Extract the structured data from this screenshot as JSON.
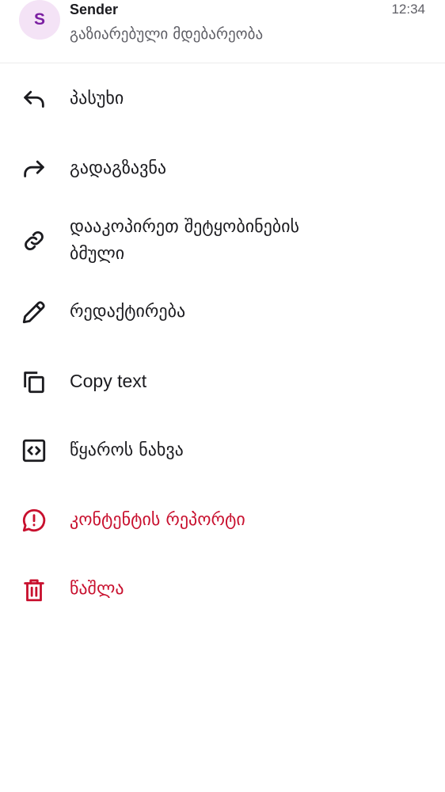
{
  "header": {
    "avatar_letter": "S",
    "sender_name": "Sender",
    "preview": "გაზიარებული მდებარეობა",
    "time": "12:34"
  },
  "menu": {
    "items": [
      {
        "label": "პასუხი",
        "icon": "reply-icon"
      },
      {
        "label": "გადაგზავნა",
        "icon": "forward-icon"
      },
      {
        "label_line1": "დააკოპირეთ შეტყობინების",
        "label_line2": "ბმული",
        "icon": "link-icon"
      },
      {
        "label": "რედაქტირება",
        "icon": "pencil-icon"
      },
      {
        "label": "Copy text",
        "icon": "copy-icon"
      },
      {
        "label": "წყაროს ნახვა",
        "icon": "code-icon"
      },
      {
        "label": "კონტენტის რეპორტი",
        "icon": "report-icon"
      },
      {
        "label": "წაშლა",
        "icon": "trash-icon"
      }
    ]
  },
  "colors": {
    "text": "#1b1b1f",
    "secondary_text": "#5f5f66",
    "danger": "#c8102e",
    "avatar_bg": "#f4e3f6",
    "avatar_fg": "#7b1fa2"
  }
}
